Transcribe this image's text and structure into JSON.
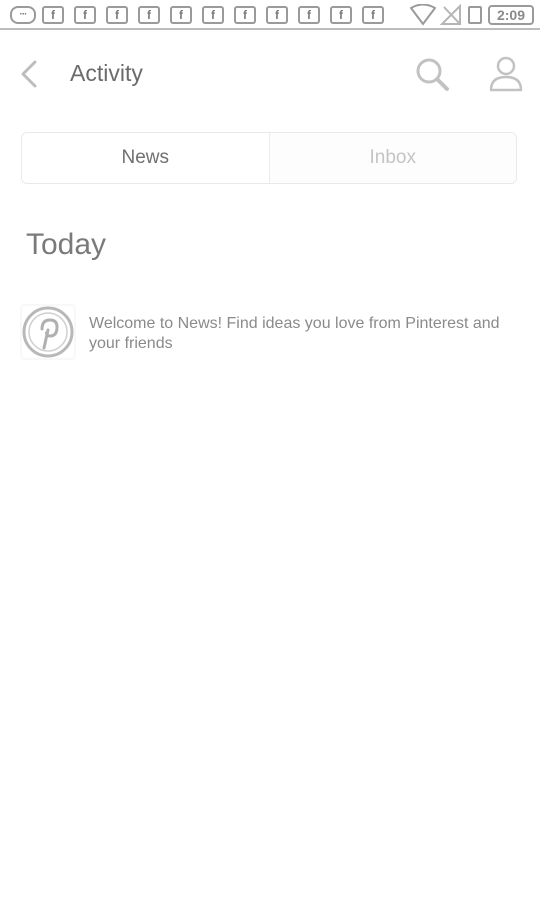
{
  "status_bar": {
    "chat_glyph": "···",
    "notification_glyph": "f",
    "notification_count_icons": [
      "facebook-icon",
      "facebook-icon",
      "facebook-icon",
      "facebook-icon",
      "facebook-icon",
      "facebook-icon",
      "facebook-icon",
      "facebook-icon",
      "facebook-icon",
      "facebook-icon",
      "facebook-icon"
    ],
    "time": "2:09"
  },
  "header": {
    "title": "Activity",
    "back_icon": "chevron-left-icon",
    "search_icon": "search-icon",
    "profile_icon": "person-icon"
  },
  "tabs": [
    {
      "label": "News",
      "active": true
    },
    {
      "label": "Inbox",
      "active": false
    }
  ],
  "section": {
    "title": "Today"
  },
  "news_items": [
    {
      "icon": "pinterest-logo-icon",
      "text": "Welcome to News! Find ideas you love from Pinterest and your friends"
    }
  ],
  "colors": {
    "background": "#ffffff",
    "text_primary": "#6b6b6b",
    "text_muted": "#c4c4c4"
  }
}
